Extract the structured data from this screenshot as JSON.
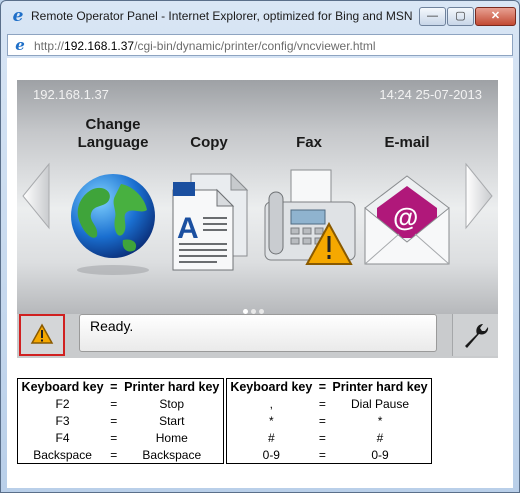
{
  "window": {
    "title": "Remote Operator Panel - Internet Explorer, optimized for Bing and MSN",
    "address_prefix": "http://",
    "address_host": "192.168.1.37",
    "address_path": "/cgi-bin/dynamic/printer/config/vncviewer.html",
    "buttons": {
      "minimize": "—",
      "maximize": "▢",
      "close": "✕"
    }
  },
  "panel": {
    "ip": "192.168.1.37",
    "datetime": "14:24 25-07-2013",
    "tiles": [
      {
        "label": "Change\nLanguage",
        "icon": "globe-icon"
      },
      {
        "label": "Copy",
        "icon": "copy-document-icon"
      },
      {
        "label": "Fax",
        "icon": "fax-machine-icon"
      },
      {
        "label": "E-mail",
        "icon": "email-envelope-icon"
      }
    ],
    "page_dots": 3,
    "active_dot": 0
  },
  "status": {
    "text": "Ready.",
    "alert_icon": "warning-triangle-icon",
    "settings_icon": "wrench-icon"
  },
  "key_table_1": {
    "headers": [
      "Keyboard key",
      "=",
      "Printer hard key"
    ],
    "rows": [
      [
        "F2",
        "=",
        "Stop"
      ],
      [
        "F3",
        "=",
        "Start"
      ],
      [
        "F4",
        "=",
        "Home"
      ],
      [
        "Backspace",
        "=",
        "Backspace"
      ]
    ]
  },
  "key_table_2": {
    "headers": [
      "Keyboard key",
      "=",
      "Printer hard key"
    ],
    "rows": [
      [
        ",",
        "=",
        "Dial Pause"
      ],
      [
        "*",
        "=",
        "*"
      ],
      [
        "#",
        "=",
        "#"
      ],
      [
        "0-9",
        "=",
        "0-9"
      ]
    ]
  },
  "colors": {
    "alert_border": "#d02020",
    "warning_fill": "#f5a800",
    "email_magenta": "#b0187a"
  }
}
